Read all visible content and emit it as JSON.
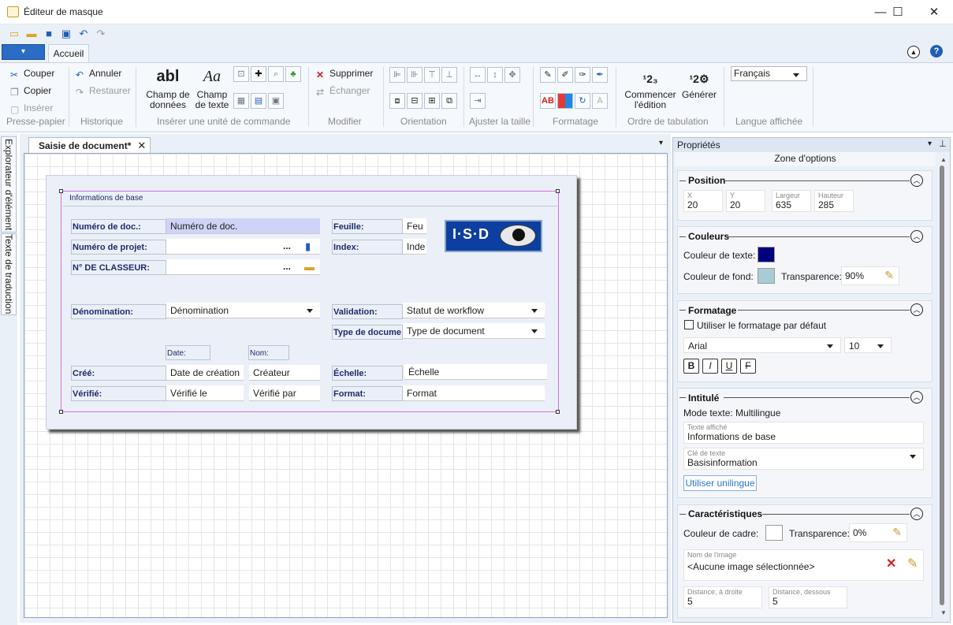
{
  "window": {
    "title": "Éditeur de masque",
    "minimize": "—",
    "maximize": "☐",
    "close": "✕"
  },
  "tabs": {
    "accueil": "Accueil"
  },
  "ribbon": {
    "clipboard": {
      "couper": "Couper",
      "copier": "Copier",
      "inserer": "Insérer",
      "group": "Presse-papier"
    },
    "history": {
      "annuler": "Annuler",
      "restaurer": "Restaurer",
      "group": "Historique"
    },
    "insert": {
      "champ_donnees": "Champ de\ndonnées",
      "champ_texte": "Champ\nde texte",
      "group": "Insérer une unité de commande",
      "abl": "abl",
      "aa": "Aa"
    },
    "modify": {
      "supprimer": "Supprimer",
      "echanger": "Échanger",
      "group": "Modifier"
    },
    "orientation": {
      "group": "Orientation"
    },
    "resize": {
      "group": "Ajuster la taille"
    },
    "format": {
      "group": "Formatage",
      "ab": "AB"
    },
    "taborder": {
      "commencer": "Commencer\nl'édition",
      "generer": "Générer",
      "group": "Ordre de tabulation"
    },
    "language": {
      "selected": "Français",
      "group": "Langue affichée"
    }
  },
  "sidetabs": {
    "explorer": "Explorateur d'élément",
    "translation": "Texte de traduction"
  },
  "document": {
    "tab_label": "Saisie de document*",
    "group_title": "Informations de base",
    "fields": {
      "numero_doc_label": "Numéro de doc.:",
      "numero_doc_value": "Numéro de doc.",
      "numero_projet_label": "Numéro de projet:",
      "classeur_label": "N° DE CLASSEUR:",
      "denomination_label": "Dénomination:",
      "denomination_value": "Dénomination",
      "date_label": "Date:",
      "nom_label": "Nom:",
      "cree_label": "Créé:",
      "cree_date": "Date de création",
      "cree_nom": "Créateur",
      "verifie_label": "Vérifié:",
      "verifie_date": "Vérifié le",
      "verifie_nom": "Vérifié par",
      "feuille_label": "Feuille:",
      "feuille_value": "Feu",
      "index_label": "Index:",
      "index_value": "Inde",
      "validation_label": "Validation:",
      "validation_value": "Statut de workflow",
      "type_label": "Type de docume",
      "type_value": "Type de document",
      "echelle_label": "Échelle:",
      "echelle_value": "Échelle",
      "format_label": "Format:",
      "format_value": "Format",
      "ellipsis": "..."
    },
    "logo_text": "I·S·D"
  },
  "properties": {
    "header": "Propriétés",
    "subheader": "Zone d'options",
    "position": {
      "title": "Position",
      "x_cap": "X",
      "x": "20",
      "y_cap": "Y",
      "y": "20",
      "w_cap": "Largeur",
      "w": "635",
      "h_cap": "Hauteur",
      "h": "285"
    },
    "colors": {
      "title": "Couleurs",
      "text_label": "Couleur de texte:",
      "text_color": "#00007f",
      "bg_label": "Couleur de fond:",
      "bg_color": "#a8ccd4",
      "transp_label": "Transparence:",
      "transp": "90%"
    },
    "formatting": {
      "title": "Formatage",
      "default_label": "Utiliser le formatage par défaut",
      "font": "Arial",
      "size": "10",
      "bold": "B",
      "italic": "I",
      "underline": "U",
      "strike": "F"
    },
    "caption": {
      "title": "Intitulé",
      "mode": "Mode texte: Multilingue",
      "shown_cap": "Texte affiché",
      "shown": "Informations de base",
      "key_cap": "Clé de texte",
      "key": "Basisinformation",
      "unilingual": "Utiliser unilingue"
    },
    "traits": {
      "title": "Caractéristiques",
      "frame_label": "Couleur de cadre:",
      "frame_color": "#ffffff",
      "transp_label": "Transparence:",
      "transp": "0%",
      "image_cap": "Nom de l'image",
      "image": "<Aucune image sélectionnée>",
      "dist_right_cap": "Distance, à droite",
      "dist_right": "5",
      "dist_below_cap": "Distance, dessous",
      "dist_below": "5"
    }
  }
}
